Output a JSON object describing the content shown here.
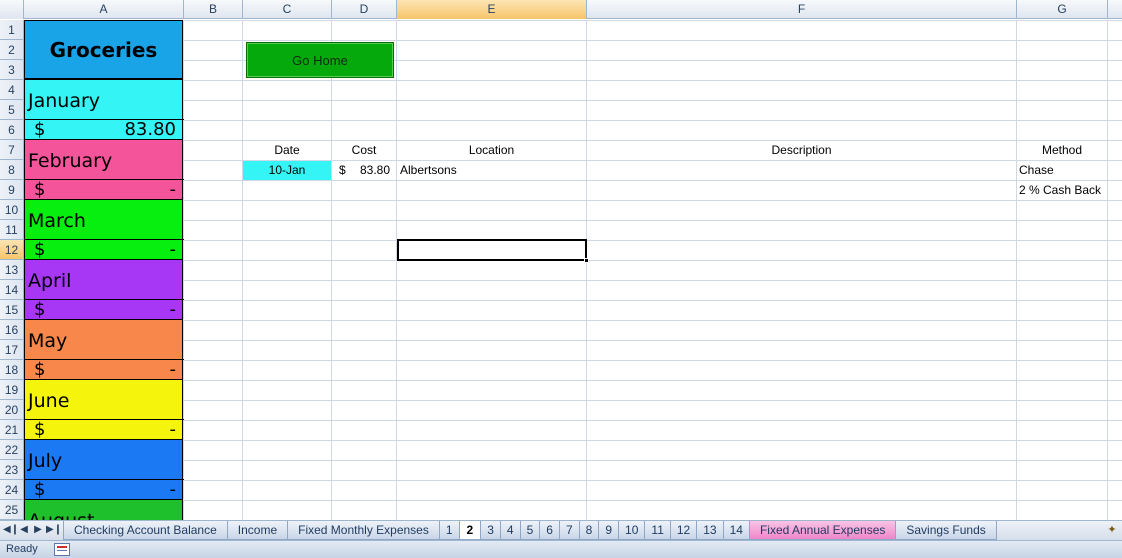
{
  "columns": [
    "A",
    "B",
    "C",
    "D",
    "E",
    "F",
    "G"
  ],
  "rows": [
    "1",
    "2",
    "3",
    "4",
    "5",
    "6",
    "7",
    "8",
    "9",
    "10",
    "11",
    "12",
    "13",
    "14",
    "15",
    "16",
    "17",
    "18",
    "19",
    "20",
    "21",
    "22",
    "23",
    "24",
    "25"
  ],
  "title": "Groceries",
  "button": {
    "label": "Go Home",
    "color": "#06a90b"
  },
  "months": [
    {
      "name": "January",
      "currency": "$",
      "value": "83.80",
      "color": "#35f4f6"
    },
    {
      "name": "February",
      "currency": "$",
      "value": "-",
      "color": "#f4559a"
    },
    {
      "name": "March",
      "currency": "$",
      "value": "-",
      "color": "#07ef0e"
    },
    {
      "name": "April",
      "currency": "$",
      "value": "-",
      "color": "#a736f5"
    },
    {
      "name": "May",
      "currency": "$",
      "value": "-",
      "color": "#f7874a"
    },
    {
      "name": "June",
      "currency": "$",
      "value": "-",
      "color": "#f4f40c"
    },
    {
      "name": "July",
      "currency": "$",
      "value": "-",
      "color": "#1c79f4"
    },
    {
      "name": "August",
      "color": "#1ec12b"
    }
  ],
  "table": {
    "headers": {
      "date": "Date",
      "cost": "Cost",
      "location": "Location",
      "description": "Description",
      "method": "Method"
    },
    "rows": [
      {
        "date": "10-Jan",
        "cost_currency": "$",
        "cost": "83.80",
        "location": "Albertsons",
        "description": "",
        "method": "Chase",
        "method_note": "2 % Cash Back"
      }
    ],
    "date_highlight": "#35f4f6"
  },
  "sheet_tabs": [
    {
      "label": "Checking Account Balance"
    },
    {
      "label": "Income"
    },
    {
      "label": "Fixed Monthly Expenses"
    },
    {
      "label": "1"
    },
    {
      "label": "2",
      "active": true
    },
    {
      "label": "3"
    },
    {
      "label": "4"
    },
    {
      "label": "5"
    },
    {
      "label": "6"
    },
    {
      "label": "7"
    },
    {
      "label": "8"
    },
    {
      "label": "9"
    },
    {
      "label": "10"
    },
    {
      "label": "11"
    },
    {
      "label": "12"
    },
    {
      "label": "13"
    },
    {
      "label": "14"
    },
    {
      "label": "Fixed Annual Expenses",
      "pink": true
    },
    {
      "label": "Savings Funds"
    }
  ],
  "status": {
    "text": "Ready"
  },
  "selection": {
    "column": "E",
    "row": "12"
  }
}
